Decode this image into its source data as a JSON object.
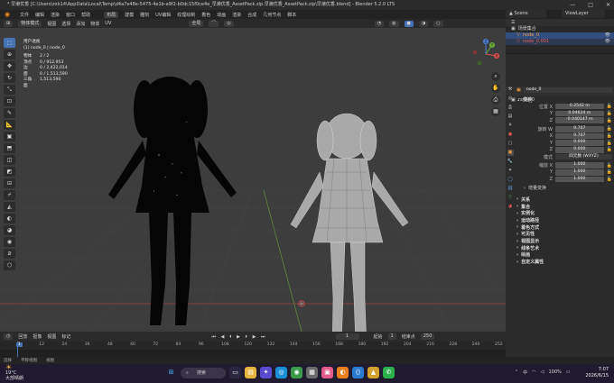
{
  "window": {
    "title": "* 早濑优香 [C:\\Users\\zxk14\\AppData\\Local\\Temp\\d4a7e48e-5475-4e1b-a9f2-b0dc15f0ce4e_早濑优香_AssetPack.zip.早濑优香_AssetPack.zip\\早濑优香.blend] - Blender 5.2.0 LTS",
    "controls": [
      "—",
      "□",
      "✕"
    ]
  },
  "menu": {
    "items": [
      "文件",
      "编辑",
      "渲染",
      "窗口",
      "帮助"
    ],
    "workspaces": [
      "布局",
      "建模",
      "雕刻",
      "UV编辑",
      "纹理绘制",
      "着色",
      "动画",
      "渲染",
      "合成",
      "几何节点",
      "脚本"
    ],
    "active": "布局",
    "scene": "Scene",
    "view_layer": "ViewLayer"
  },
  "header": {
    "mode": "物体模式",
    "items": [
      "视图",
      "选择",
      "添加",
      "物体"
    ],
    "transform": "全局",
    "extra": "UV"
  },
  "viewport": {
    "stats_title": "用户透视",
    "stats_subtitle": "(1) node_0 | node_0",
    "stats": [
      {
        "k": "物体",
        "v": "2 / 2"
      },
      {
        "k": "顶点",
        "v": "0 / 912,953"
      },
      {
        "k": "边",
        "v": "0 / 2,422,014"
      },
      {
        "k": "面",
        "v": "0 / 1,513,590"
      },
      {
        "k": "三角面",
        "v": "1,513,590"
      }
    ],
    "gizmo": {
      "x": "X",
      "y": "Y",
      "z": "Z"
    }
  },
  "outliner": {
    "title": "场景集合",
    "items": [
      {
        "name": "node_0",
        "selected": true
      },
      {
        "name": "node_0.001",
        "selected": false
      }
    ]
  },
  "properties": {
    "object_path": "node_0",
    "object_name": "node_0",
    "section_transform": "变换",
    "location": {
      "label": "位置 X",
      "x": "0.2542 m",
      "y": "0.04634 m",
      "z": "-0.040147 m"
    },
    "rotation": {
      "label": "旋转 W",
      "w": "0.707",
      "x": "0.707",
      "y": "0.000",
      "z": "0.000"
    },
    "rotation_mode_label": "模式",
    "rotation_mode": "四元数 (WXYZ)",
    "scale": {
      "label": "缩放 X",
      "x": "1.000",
      "y": "1.000",
      "z": "1.000"
    },
    "delta": "增量变换",
    "sections": [
      "关系",
      "集合",
      "实例化",
      "运动路径",
      "着色方式",
      "可见性",
      "视图显示",
      "线条艺术",
      "绘画",
      "自定义属性"
    ]
  },
  "timeline": {
    "items": [
      "回放",
      "抠像",
      "视图",
      "标记"
    ],
    "current": "1",
    "start_label": "起始",
    "start": "1",
    "end_label": "结束点",
    "end": "250",
    "frames": [
      "1",
      "12",
      "24",
      "36",
      "48",
      "60",
      "72",
      "84",
      "96",
      "108",
      "120",
      "132",
      "144",
      "156",
      "168",
      "180",
      "192",
      "204",
      "216",
      "228",
      "240",
      "252"
    ]
  },
  "statusbar": {
    "items": [
      "选择",
      "平移视图",
      "视图"
    ]
  },
  "taskbar": {
    "temp": "19°C",
    "weather": "大部晴朗",
    "search": "搜索",
    "time": "7:07",
    "date": "2026/6/15",
    "battery": "100%",
    "lang": "中"
  }
}
